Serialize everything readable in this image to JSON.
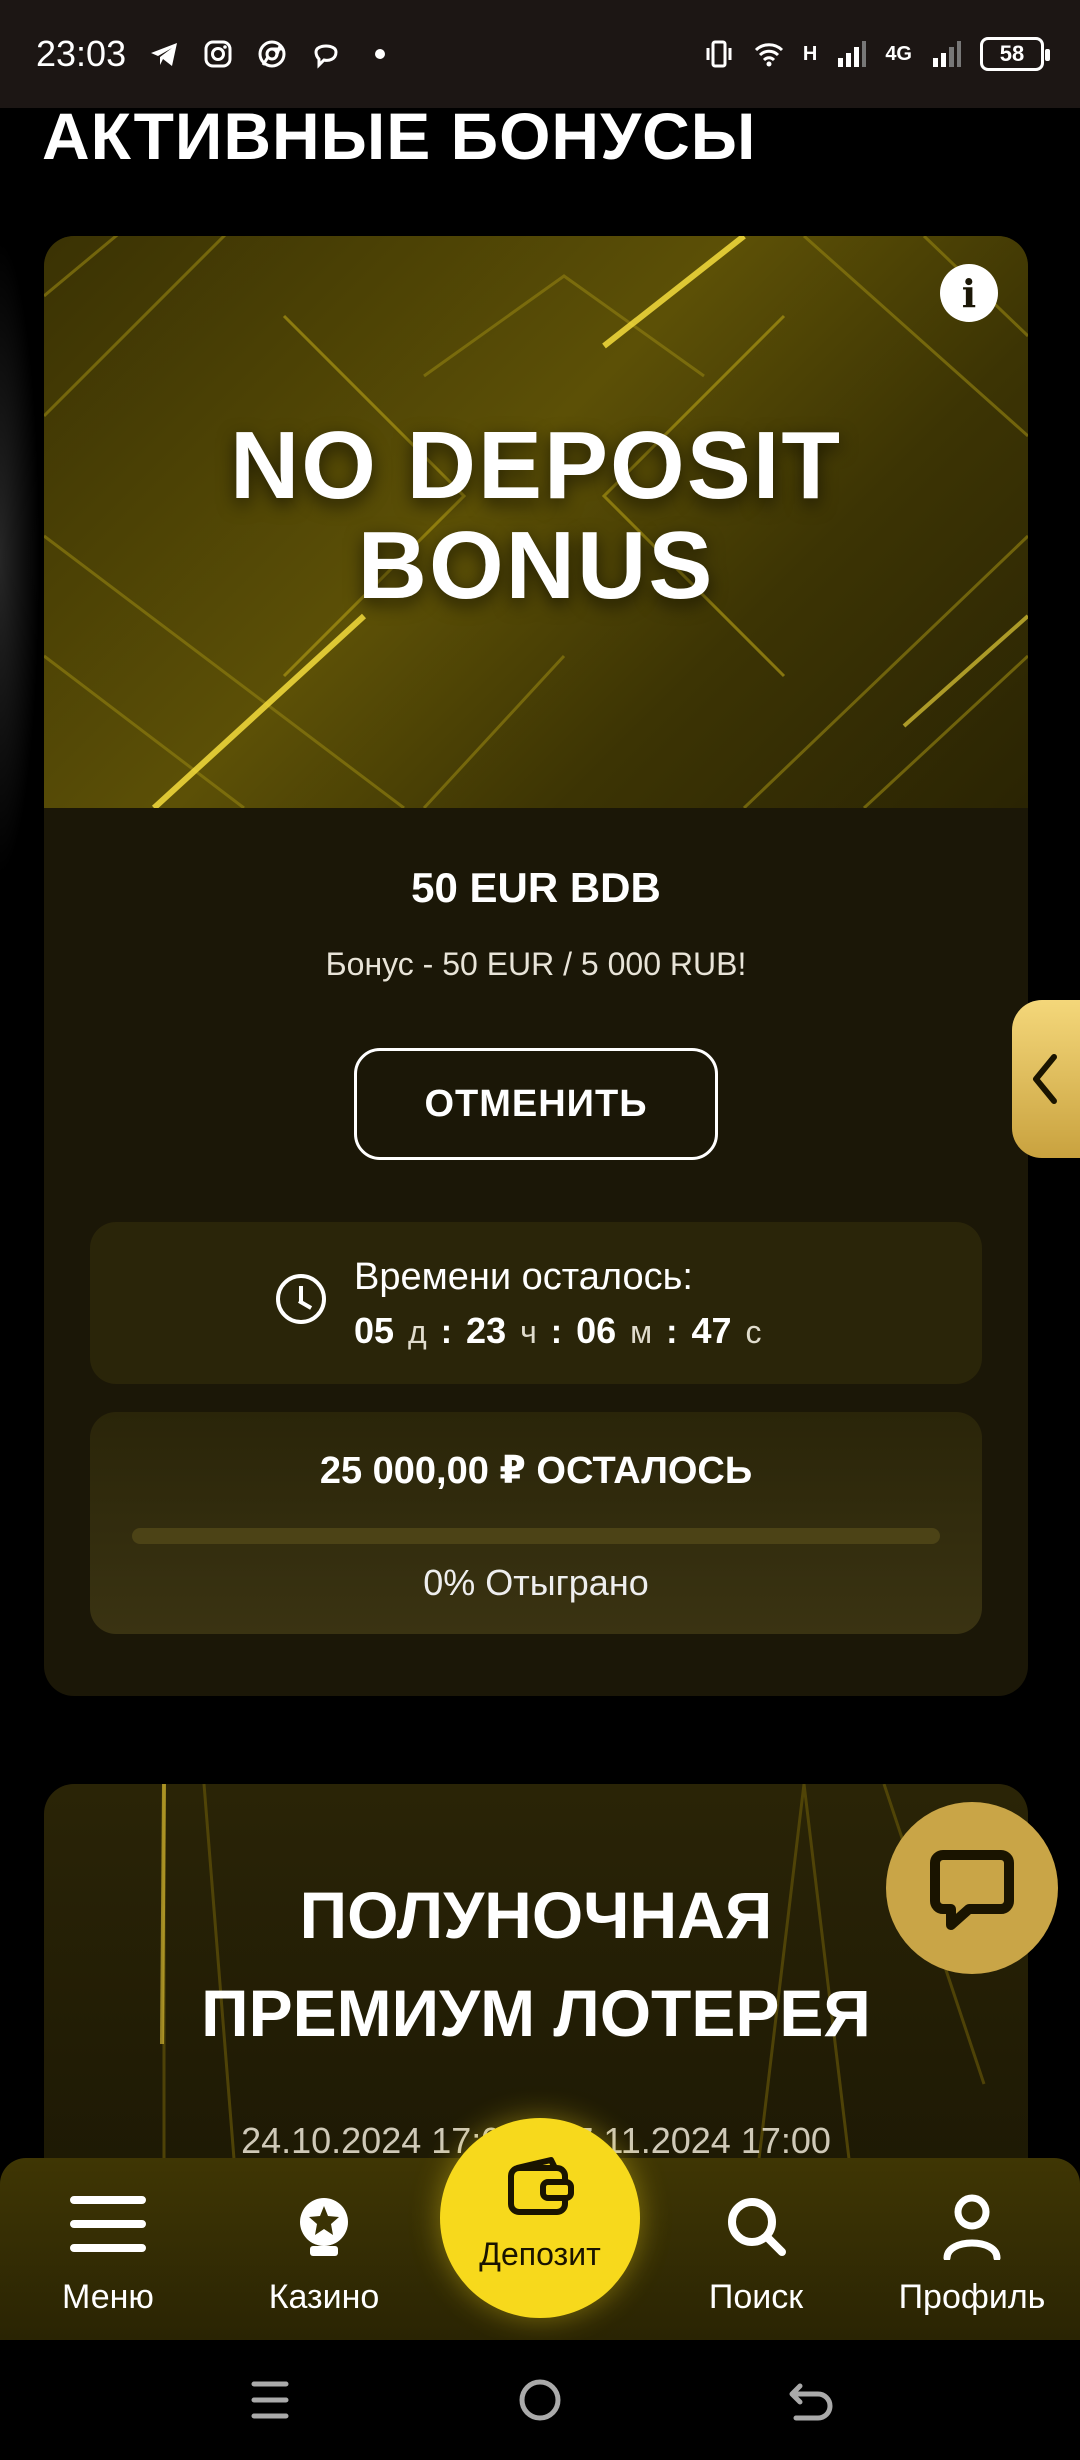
{
  "status_bar": {
    "time": "23:03",
    "network_h": "H",
    "network_4g": "4G",
    "battery": "58"
  },
  "page": {
    "heading": "АКТИВНЫЕ БОНУСЫ"
  },
  "bonus": {
    "banner_title_line1": "NO DEPOSIT",
    "banner_title_line2": "BONUS",
    "name": "50 EUR BDB",
    "description": "Бонус - 50 EUR / 5 000 RUB!",
    "cancel_label": "ОТМЕНИТЬ",
    "timer": {
      "label": "Времени осталось:",
      "days": "05",
      "days_unit": "д",
      "hours": "23",
      "hours_unit": "ч",
      "minutes": "06",
      "minutes_unit": "м",
      "seconds": "47",
      "seconds_unit": "с",
      "separator": ":"
    },
    "progress": {
      "remaining": "25 000,00 ₽ ОСТАЛОСЬ",
      "played": "0% Отыграно",
      "fraction": 0
    }
  },
  "lottery": {
    "title_line1": "ПОЛУНОЧНАЯ",
    "title_line2": "ПРЕМИУМ ЛОТЕРЕЯ",
    "dates": "24.10.2024 17:00 - 07.11.2024 17:00"
  },
  "bottom_nav": {
    "menu": "Меню",
    "casino": "Казино",
    "deposit": "Депозит",
    "search": "Поиск",
    "profile": "Профиль"
  },
  "colors": {
    "accent": "#f7d91c",
    "background": "#000000",
    "card": "#1b1707"
  }
}
